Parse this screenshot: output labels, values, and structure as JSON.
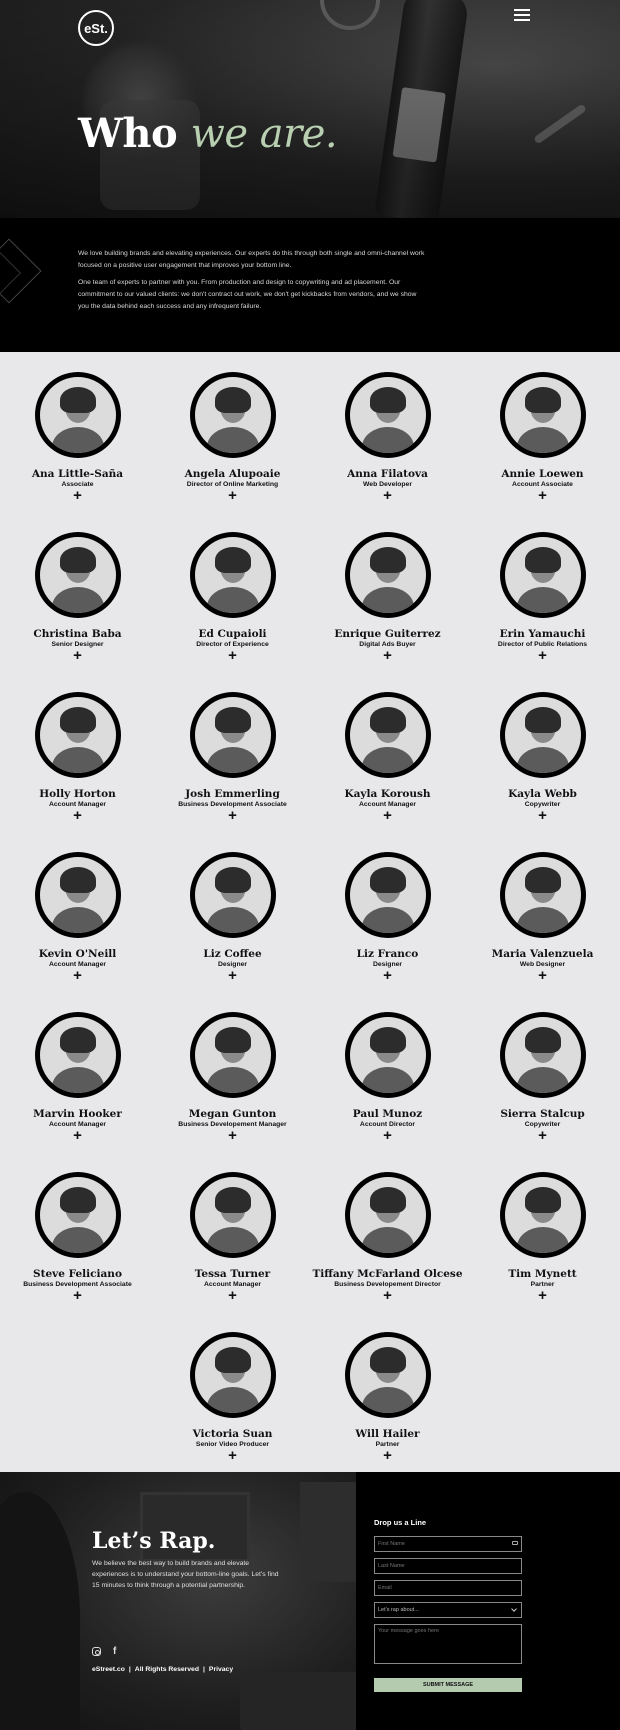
{
  "header": {
    "logo_text": "eSt.",
    "title_plain": "Who",
    "title_accent": "we are."
  },
  "intro": {
    "paragraph_1": "We love building brands and elevating experiences. Our experts do this through both single and omni-channel work focused on a positive user engagement that improves your bottom line.",
    "paragraph_2": "One team of experts to partner with you. From production and design to copywriting and ad placement. Our commitment to our valued clients: we don't contract out work, we don't get kickbacks from vendors, and we show you the data behind each success and any infrequent failure."
  },
  "team": [
    {
      "name": "Ana Little-Saña",
      "role": "Associate"
    },
    {
      "name": "Angela Alupoaie",
      "role": "Director of Online Marketing"
    },
    {
      "name": "Anna Filatova",
      "role": "Web Developer"
    },
    {
      "name": "Annie Loewen",
      "role": "Account Associate"
    },
    {
      "name": "Christina Baba",
      "role": "Senior Designer"
    },
    {
      "name": "Ed Cupaioli",
      "role": "Director of Experience"
    },
    {
      "name": "Enrique Guiterrez",
      "role": "Digital Ads Buyer"
    },
    {
      "name": "Erin Yamauchi",
      "role": "Director of Public Relations"
    },
    {
      "name": "Holly Horton",
      "role": "Account Manager"
    },
    {
      "name": "Josh Emmerling",
      "role": "Business Development Associate"
    },
    {
      "name": "Kayla Koroush",
      "role": "Account Manager"
    },
    {
      "name": "Kayla Webb",
      "role": "Copywriter"
    },
    {
      "name": "Kevin O'Neill",
      "role": "Account Manager"
    },
    {
      "name": "Liz Coffee",
      "role": "Designer"
    },
    {
      "name": "Liz Franco",
      "role": "Designer"
    },
    {
      "name": "Maria Valenzuela",
      "role": "Web Designer"
    },
    {
      "name": "Marvin Hooker",
      "role": "Account Manager"
    },
    {
      "name": "Megan Gunton",
      "role": "Business Developement Manager"
    },
    {
      "name": "Paul Munoz",
      "role": "Account Director"
    },
    {
      "name": "Sierra Stalcup",
      "role": "Copywriter"
    },
    {
      "name": "Steve Feliciano",
      "role": "Business Development Associate"
    },
    {
      "name": "Tessa Turner",
      "role": "Account Manager"
    },
    {
      "name": "Tiffany McFarland Olcese",
      "role": "Business Developement Director"
    },
    {
      "name": "Tim Mynett",
      "role": "Partner"
    },
    {
      "name": "Victoria Suan",
      "role": "Senior Video Producer"
    },
    {
      "name": "Will Hailer",
      "role": "Partner"
    }
  ],
  "expand_symbol": "+",
  "footer": {
    "title": "Let’s Rap.",
    "text": "We believe the best way to build brands and elevate experiences is to understand your bottom-line goals. Let’s find 15 minutes to think through a potential partnership.",
    "site": "eStreet.co",
    "sep": "|",
    "rights": "All Rights Reserved",
    "privacy": "Privacy",
    "social_icons": [
      "instagram-icon",
      "facebook-icon"
    ],
    "facebook_glyph": "f"
  },
  "form": {
    "title": "Drop us a Line",
    "first_name_placeholder": "First Name",
    "last_name_placeholder": "Last Name",
    "email_placeholder": "Email",
    "topic_selected": "Let's rap about...",
    "message_placeholder": "Your message goes here",
    "submit_label": "SUBMIT MESSAGE"
  },
  "colors": {
    "accent": "#b9cfb1",
    "button": "#b5cbb0",
    "background": "#e8e8ea",
    "dark": "#000000"
  }
}
